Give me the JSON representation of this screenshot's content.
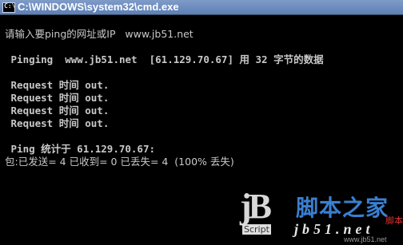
{
  "window": {
    "title": "C:\\WINDOWS\\system32\\cmd.exe",
    "icon": "console-icon",
    "icon_glyph": "C:\\"
  },
  "console": {
    "lines": [
      "请输入要ping的网址或IP   www.jb51.net",
      " Pinging  www.jb51.net  [61.129.70.67] 用 32 字节的数据",
      " Request 时间 out.",
      " Request 时间 out.",
      " Request 时间 out.",
      " Request 时间 out.",
      " Ping 统计于 61.129.70.67:",
      "包:已发送= 4 已收到= 0 已丢失= 4  (100% 丢失)"
    ]
  },
  "watermark": {
    "logo_text": "jB",
    "script_label": "Script",
    "site_name": "脚本之家",
    "latin_text": "jb51.net",
    "red_label": "脚本",
    "url": "www.jb51.net"
  }
}
